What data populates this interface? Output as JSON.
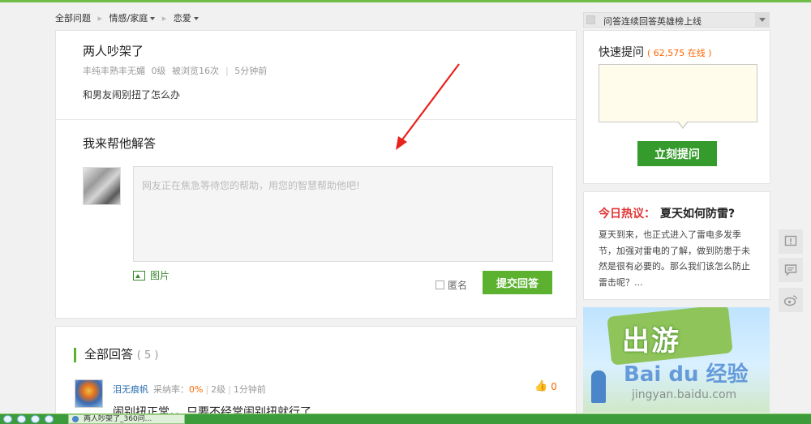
{
  "breadcrumb": {
    "items": [
      {
        "label": "全部问题",
        "dropdown": false
      },
      {
        "label": "情感/家庭",
        "dropdown": true
      },
      {
        "label": "恋爱",
        "dropdown": true
      }
    ]
  },
  "question": {
    "title": "两人吵架了",
    "asker": "丰纯丰熟丰无媚",
    "level": "0级",
    "views": "被浏览16次",
    "time": "5分钟前",
    "body": "和男友闹别扭了怎么办"
  },
  "answer_form": {
    "title": "我来帮他解答",
    "placeholder": "网友正在焦急等待您的帮助，用您的智慧帮助他吧!",
    "image_label": "图片",
    "anonymous_label": "匿名",
    "submit_label": "提交回答"
  },
  "answers": {
    "title": "全部回答",
    "count": "( 5 )",
    "first": {
      "user": "泪无痕帆",
      "rate_label": "采纳率：",
      "rate_value": "0%",
      "level": "2级",
      "time": "1分钟前",
      "likes": "0",
      "text": "闹别扭正常。。只要不经常闹别扭就行了"
    }
  },
  "sidebar": {
    "hero_bar": "问答连续回答英雄榜上线",
    "quick_ask": {
      "title": "快速提问",
      "online": "( 62,575 在线 )",
      "button": "立刻提问"
    },
    "hot_topic": {
      "label": "今日热议：",
      "topic": "夏天如何防雷?",
      "text": "夏天到来，也正式进入了雷电多发季节，加强对雷电的了解，做到防患于未然是很有必要的。那么我们该怎么防止雷击呢？..."
    },
    "banner": {
      "text": "出游",
      "logo": "Bai du 经验",
      "url": "jingyan.baidu.com"
    }
  },
  "taskbar": {
    "task_title": "两人吵架了_360问..."
  },
  "colors": {
    "accent_green": "#5cb22f",
    "dark_green": "#359b2c",
    "orange": "#ff6600",
    "red": "#e03434",
    "link_blue": "#2a6fb0"
  }
}
